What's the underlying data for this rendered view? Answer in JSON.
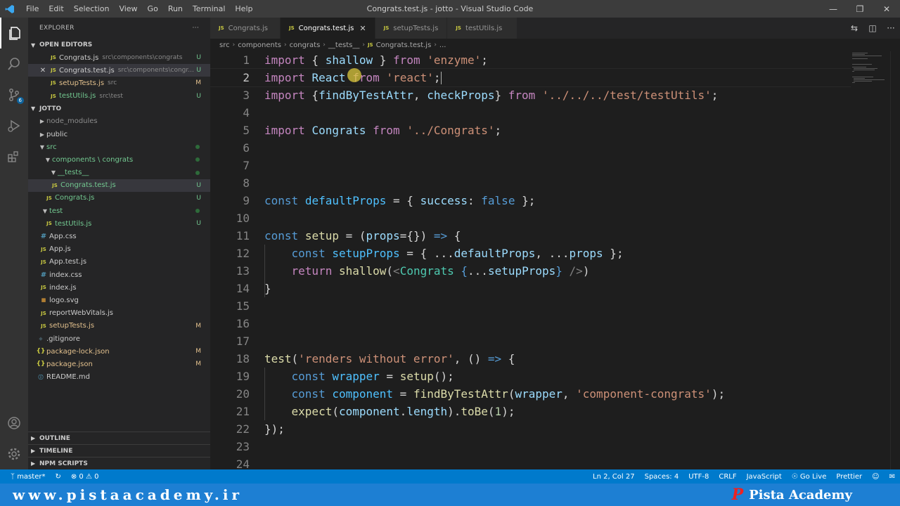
{
  "window": {
    "title": "Congrats.test.js - jotto - Visual Studio Code"
  },
  "menu": [
    "File",
    "Edit",
    "Selection",
    "View",
    "Go",
    "Run",
    "Terminal",
    "Help"
  ],
  "activity": {
    "badge": "6"
  },
  "explorer": {
    "header": "EXPLORER",
    "open_editors_title": "OPEN EDITORS",
    "open_editors": [
      {
        "name": "Congrats.js",
        "path": "src\\components\\congrats",
        "status": "U"
      },
      {
        "name": "Congrats.test.js",
        "path": "src\\components\\congr...",
        "status": "U"
      },
      {
        "name": "setupTests.js",
        "path": "src",
        "status": "M"
      },
      {
        "name": "testUtils.js",
        "path": "src\\test",
        "status": "U"
      }
    ],
    "project_title": "JOTTO",
    "tree": [
      {
        "name": "node_modules"
      },
      {
        "name": "public"
      },
      {
        "name": "src"
      },
      {
        "name": "components \\ congrats"
      },
      {
        "name": "__tests__"
      },
      {
        "name": "Congrats.test.js",
        "status": "U"
      },
      {
        "name": "Congrats.js",
        "status": "U"
      },
      {
        "name": "test"
      },
      {
        "name": "testUtils.js",
        "status": "U"
      },
      {
        "name": "App.css"
      },
      {
        "name": "App.js"
      },
      {
        "name": "App.test.js"
      },
      {
        "name": "index.css"
      },
      {
        "name": "index.js"
      },
      {
        "name": "logo.svg"
      },
      {
        "name": "reportWebVitals.js"
      },
      {
        "name": "setupTests.js",
        "status": "M"
      },
      {
        "name": ".gitignore"
      },
      {
        "name": "package-lock.json",
        "status": "M"
      },
      {
        "name": "package.json",
        "status": "M"
      },
      {
        "name": "README.md"
      }
    ],
    "bottom_sections": [
      "OUTLINE",
      "TIMELINE",
      "NPM SCRIPTS"
    ]
  },
  "tabs": [
    {
      "label": "Congrats.js"
    },
    {
      "label": "Congrats.test.js"
    },
    {
      "label": "setupTests.js"
    },
    {
      "label": "testUtils.js"
    }
  ],
  "breadcrumb": [
    "src",
    "components",
    "congrats",
    "__tests__",
    "Congrats.test.js",
    "..."
  ],
  "editor": {
    "line_numbers": [
      "1",
      "2",
      "3",
      "4",
      "5",
      "6",
      "7",
      "8",
      "9",
      "10",
      "11",
      "12",
      "13",
      "14",
      "15",
      "16",
      "17",
      "18",
      "19",
      "20",
      "21",
      "22",
      "23",
      "24"
    ]
  },
  "status": {
    "branch": "master*",
    "problems": "0",
    "warnings": "0",
    "position": "Ln 2, Col 27",
    "spaces": "Spaces: 4",
    "encoding": "UTF-8",
    "eol": "CRLF",
    "language": "JavaScript",
    "golive": "Go Live",
    "prettier": "Prettier"
  },
  "watermark": {
    "site": "www.pistaacademy.ir",
    "brand": "Pista Academy"
  }
}
